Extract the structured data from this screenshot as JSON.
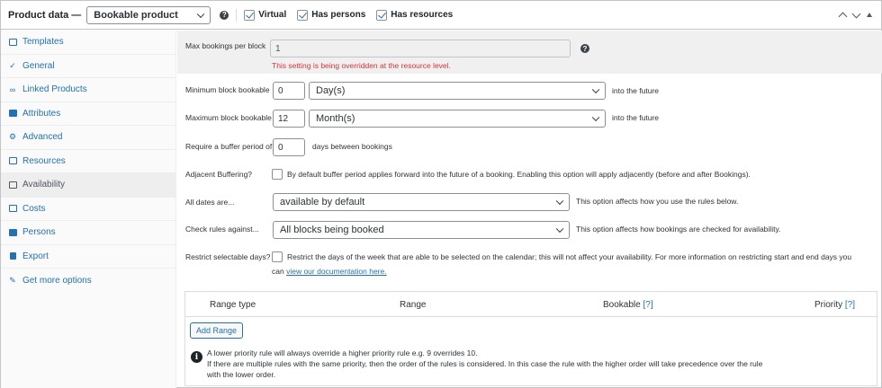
{
  "header": {
    "title": "Product data —",
    "product_type": "Bookable product",
    "checks": [
      {
        "label": "Virtual",
        "checked": true
      },
      {
        "label": "Has persons",
        "checked": true
      },
      {
        "label": "Has resources",
        "checked": true
      }
    ]
  },
  "sidebar": {
    "items": [
      {
        "label": "Templates",
        "icon": "template-icon"
      },
      {
        "label": "General",
        "icon": "wrench-icon"
      },
      {
        "label": "Linked Products",
        "icon": "link-icon"
      },
      {
        "label": "Attributes",
        "icon": "list-icon"
      },
      {
        "label": "Advanced",
        "icon": "gear-icon"
      },
      {
        "label": "Resources",
        "icon": "box-icon"
      },
      {
        "label": "Availability",
        "icon": "calendar-icon",
        "active": true
      },
      {
        "label": "Costs",
        "icon": "card-icon"
      },
      {
        "label": "Persons",
        "icon": "person-icon"
      },
      {
        "label": "Export",
        "icon": "export-icon"
      },
      {
        "label": "Get more options",
        "icon": "plugin-icon"
      }
    ]
  },
  "form": {
    "max_bookings": {
      "label": "Max bookings per block",
      "value": "1",
      "warning": "This setting is being overridden at the resource level."
    },
    "min_block": {
      "label": "Minimum block bookable",
      "value": "0",
      "unit": "Day(s)",
      "suffix": "into the future"
    },
    "max_block": {
      "label": "Maximum block bookable",
      "value": "12",
      "unit": "Month(s)",
      "suffix": "into the future"
    },
    "buffer": {
      "label": "Require a buffer period of",
      "value": "0",
      "suffix": "days between bookings"
    },
    "adjacent": {
      "label": "Adjacent Buffering?",
      "checked": false,
      "desc": "By default buffer period applies forward into the future of a booking. Enabling this option will apply adjacently (before and after Bookings)."
    },
    "all_dates": {
      "label": "All dates are...",
      "value": "available by default",
      "desc": "This option affects how you use the rules below."
    },
    "check_rules": {
      "label": "Check rules against...",
      "value": "All blocks being booked",
      "desc": "This option affects how bookings are checked for availability."
    },
    "restrict": {
      "label": "Restrict selectable days?",
      "checked": false,
      "desc_line1": "Restrict the days of the week that are able to be selected on the calendar; this will not affect your availability. For more information on restricting start and end days you",
      "desc_prefix": "can",
      "link": "view our documentation here."
    }
  },
  "rules_table": {
    "columns": [
      "Range type",
      "Range",
      "Bookable",
      "Priority"
    ],
    "help_marker": "[?]",
    "add_button": "Add Range",
    "notes": [
      "A lower priority rule will always override a higher priority rule e.g. 9 overrides 10.",
      "If there are multiple rules with the same priority, then the order of the rules is considered. In this case the rule with the higher order will take precedence over the rule",
      "with the lower order."
    ]
  },
  "colors": {
    "link": "#2271b1",
    "warning": "#d63638",
    "active_bg": "#eeeeee"
  }
}
